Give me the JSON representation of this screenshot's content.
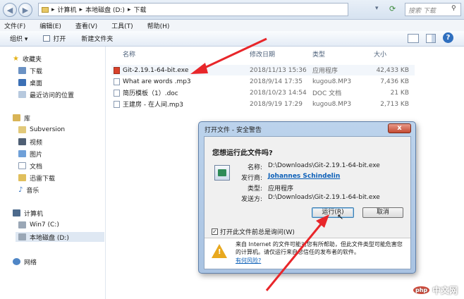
{
  "address": {
    "segments": [
      "计算机",
      "本地磁盘 (D:)",
      "下载"
    ],
    "search_placeholder": "搜索 下载"
  },
  "menu": [
    "文件(F)",
    "编辑(E)",
    "查看(V)",
    "工具(T)",
    "帮助(H)"
  ],
  "toolbar": {
    "organize": "组织 ▾",
    "open": "打开",
    "new_folder": "新建文件夹"
  },
  "nav": {
    "favorites": "收藏夹",
    "downloads": "下载",
    "desktop": "桌面",
    "recent": "最近访问的位置",
    "libraries": "库",
    "subversion": "Subversion",
    "videos": "视频",
    "pictures": "图片",
    "documents": "文档",
    "xunlei": "迅雷下载",
    "music": "音乐",
    "computer": "计算机",
    "drive_c": "Win7 (C:)",
    "drive_d": "本地磁盘 (D:)",
    "network": "网络"
  },
  "columns": {
    "name": "名称",
    "date": "修改日期",
    "type": "类型",
    "size": "大小"
  },
  "files": [
    {
      "name": "Git-2.19.1-64-bit.exe",
      "date": "2018/11/13 15:36",
      "type": "应用程序",
      "size": "42,433 KB"
    },
    {
      "name": "What are words .mp3",
      "date": "2018/9/14 17:35",
      "type": "kugou8.MP3",
      "size": "7,436 KB"
    },
    {
      "name": "简历模板（1）.doc",
      "date": "2018/10/23 14:54",
      "type": "DOC 文档",
      "size": "21 KB"
    },
    {
      "name": "王建房 - 在人间.mp3",
      "date": "2018/9/19 17:29",
      "type": "kugou8.MP3",
      "size": "2,713 KB"
    }
  ],
  "dialog": {
    "title": "打开文件 - 安全警告",
    "close": "x",
    "question": "您想运行此文件吗?",
    "name_label": "名称:",
    "name_value": "D:\\Downloads\\Git-2.19.1-64-bit.exe",
    "publisher_label": "发行商:",
    "publisher_value": "Johannes Schindelin",
    "type_label": "类型:",
    "type_value": "应用程序",
    "from_label": "发送方:",
    "from_value": "D:\\Downloads\\Git-2.19.1-64-bit.exe",
    "run_button": "运行(R)",
    "cancel_button": "取消",
    "checkbox_label": "打开此文件前总是询问(W)",
    "warning_text": "来自 Internet 的文件可能对您有所帮助，但此文件类型可能危害您的计算机。请仅运行来自您信任的发布者的软件。",
    "risk_link": "有何风险?"
  },
  "watermark": {
    "text": "中文网",
    "logo": "php"
  },
  "colors": {
    "arrow": "#e8262a",
    "link": "#0b5fb8",
    "accent": "#3b73b9"
  }
}
